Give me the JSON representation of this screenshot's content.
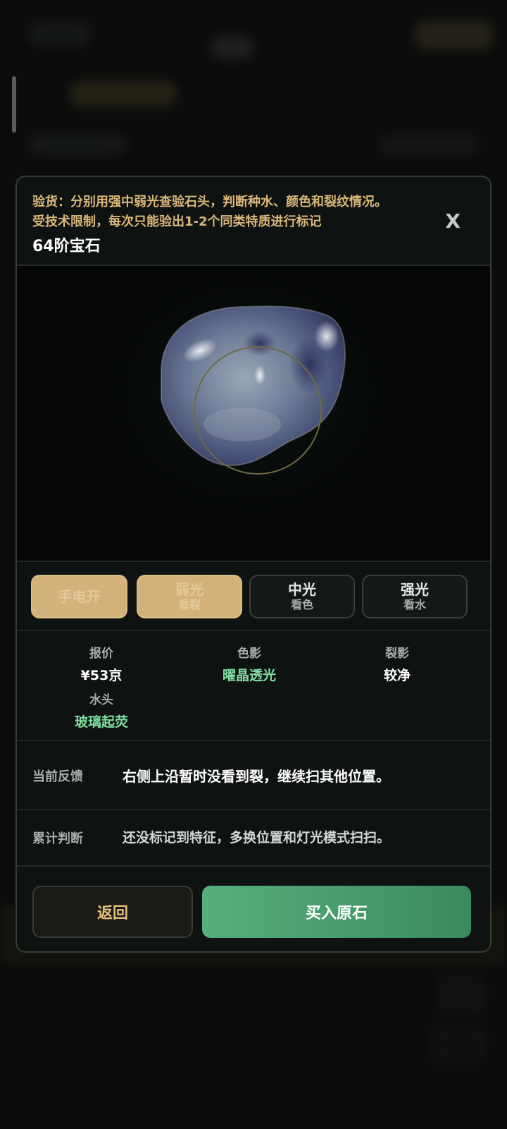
{
  "modal": {
    "notice_line1": "验货：分别用强中弱光查验石头，判断种水、颜色和裂纹情况。",
    "notice_line2": "受技术限制，每次只能验出1-2个同类特质进行标记",
    "title": "64阶宝石",
    "close_label": "X"
  },
  "lights": [
    {
      "label": "手电开",
      "sub": "",
      "state": "on"
    },
    {
      "label": "弱光",
      "sub": "看裂",
      "state": "on"
    },
    {
      "label": "中光",
      "sub": "看色",
      "state": "off"
    },
    {
      "label": "强光",
      "sub": "看水",
      "state": "off"
    }
  ],
  "attributes": {
    "quote": {
      "label": "报价",
      "value": "¥53京"
    },
    "color_shadow": {
      "label": "色影",
      "value": "曜晶透光"
    },
    "crack_shadow": {
      "label": "裂影",
      "value": "较净"
    },
    "water_head": {
      "label": "水头",
      "value": "玻璃起荧"
    }
  },
  "feedback": {
    "current_label": "当前反馈",
    "current_value": "右侧上沿暂时没看到裂，继续扫其他位置。",
    "cumulative_label": "累计判断",
    "cumulative_value": "还没标记到特征，多换位置和灯光模式扫扫。"
  },
  "actions": {
    "back_label": "返回",
    "buy_label": "买入原石"
  },
  "colors": {
    "gold": "#d9b77a",
    "green_value": "#7fe0a2",
    "buy_green": "#4fa874"
  }
}
